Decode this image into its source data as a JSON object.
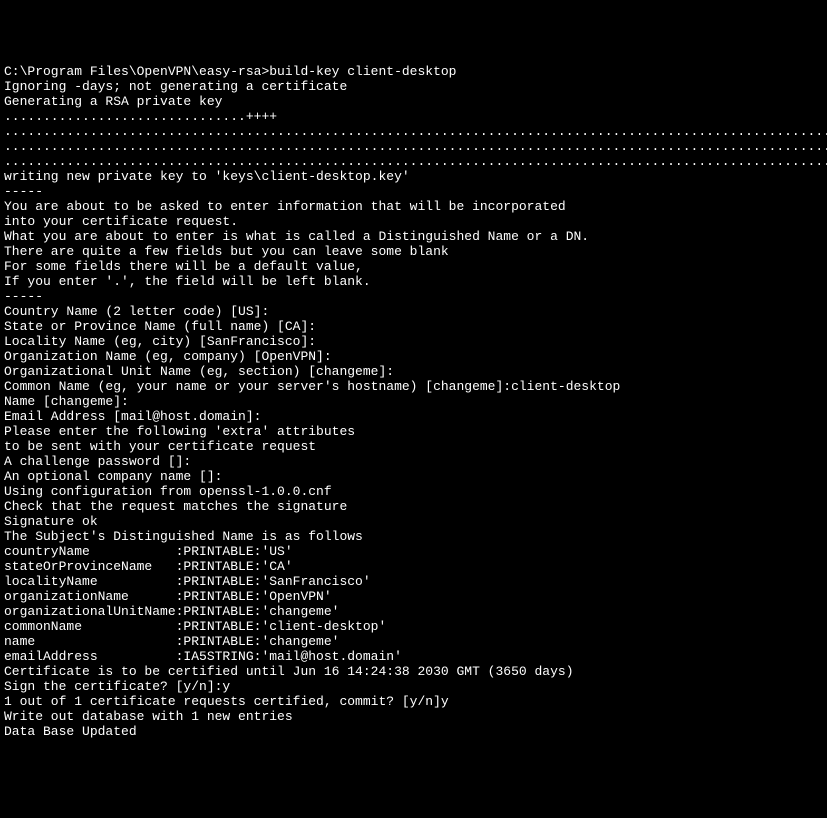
{
  "terminal": {
    "lines": [
      "C:\\Program Files\\OpenVPN\\easy-rsa>build-key client-desktop",
      "Ignoring -days; not generating a certificate",
      "Generating a RSA private key",
      "...............................++++",
      ".......................................................................................................................",
      ".......................................................................................................................",
      "...................................................................................................................++++",
      "writing new private key to 'keys\\client-desktop.key'",
      "-----",
      "You are about to be asked to enter information that will be incorporated",
      "into your certificate request.",
      "What you are about to enter is what is called a Distinguished Name or a DN.",
      "There are quite a few fields but you can leave some blank",
      "For some fields there will be a default value,",
      "If you enter '.', the field will be left blank.",
      "-----",
      "Country Name (2 letter code) [US]:",
      "State or Province Name (full name) [CA]:",
      "Locality Name (eg, city) [SanFrancisco]:",
      "Organization Name (eg, company) [OpenVPN]:",
      "Organizational Unit Name (eg, section) [changeme]:",
      "Common Name (eg, your name or your server's hostname) [changeme]:client-desktop",
      "Name [changeme]:",
      "Email Address [mail@host.domain]:",
      "",
      "Please enter the following 'extra' attributes",
      "to be sent with your certificate request",
      "A challenge password []:",
      "An optional company name []:",
      "Using configuration from openssl-1.0.0.cnf",
      "Check that the request matches the signature",
      "Signature ok",
      "The Subject's Distinguished Name is as follows",
      "countryName           :PRINTABLE:'US'",
      "stateOrProvinceName   :PRINTABLE:'CA'",
      "localityName          :PRINTABLE:'SanFrancisco'",
      "organizationName      :PRINTABLE:'OpenVPN'",
      "organizationalUnitName:PRINTABLE:'changeme'",
      "commonName            :PRINTABLE:'client-desktop'",
      "name                  :PRINTABLE:'changeme'",
      "emailAddress          :IA5STRING:'mail@host.domain'",
      "Certificate is to be certified until Jun 16 14:24:38 2030 GMT (3650 days)",
      "Sign the certificate? [y/n]:y",
      "",
      "",
      "1 out of 1 certificate requests certified, commit? [y/n]y",
      "Write out database with 1 new entries",
      "Data Base Updated"
    ]
  }
}
